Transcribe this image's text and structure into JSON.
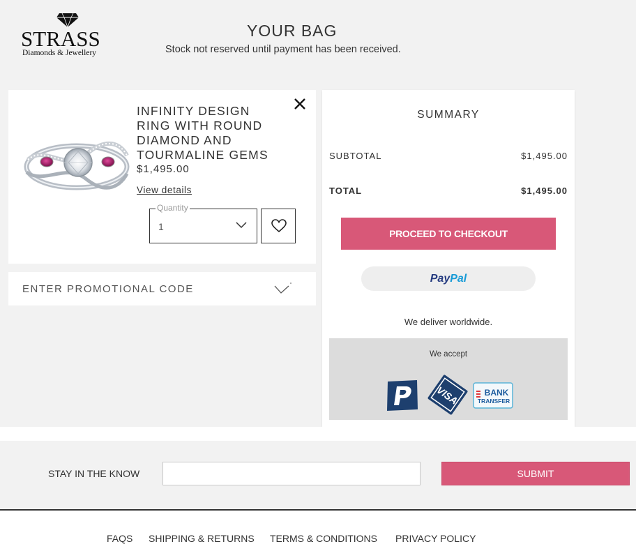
{
  "brand": {
    "name": "STRASS",
    "tagline": "Diamonds & Jewellery",
    "accent": "#d85878"
  },
  "page": {
    "title": "YOUR BAG",
    "subtitle": "Stock not reserved until payment has been received."
  },
  "item": {
    "name": "INFINITY DESIGN RING WITH ROUND DIAMOND AND TOURMALINE GEMS",
    "price": "$1,495.00",
    "view_details": "View details",
    "quantity_label": "Quantity",
    "quantity_value": "1",
    "icons": {
      "remove": "close-icon",
      "wishlist": "heart-icon",
      "quantity": "chevron-down-icon"
    }
  },
  "promo": {
    "label": "ENTER PROMOTIONAL CODE"
  },
  "summary": {
    "title": "SUMMARY",
    "subtotal_label": "SUBTOTAL",
    "subtotal_value": "$1,495.00",
    "total_label": "TOTAL",
    "total_value": "$1,495.00",
    "checkout_label": "PROCEED TO CHECKOUT",
    "paypal_part1": "Pay",
    "paypal_part2": "Pal",
    "deliver_text": "We deliver worldwide.",
    "accept_label": "We accept",
    "payment_methods": [
      "PayPal",
      "Visa",
      "Bank Transfer"
    ]
  },
  "newsletter": {
    "label": "STAY IN THE KNOW",
    "input_value": "",
    "submit_label": "SUBMIT"
  },
  "footer": {
    "links": [
      "FAQS",
      "SHIPPING & RETURNS",
      "TERMS & CONDITIONS",
      "PRIVACY POLICY"
    ]
  }
}
